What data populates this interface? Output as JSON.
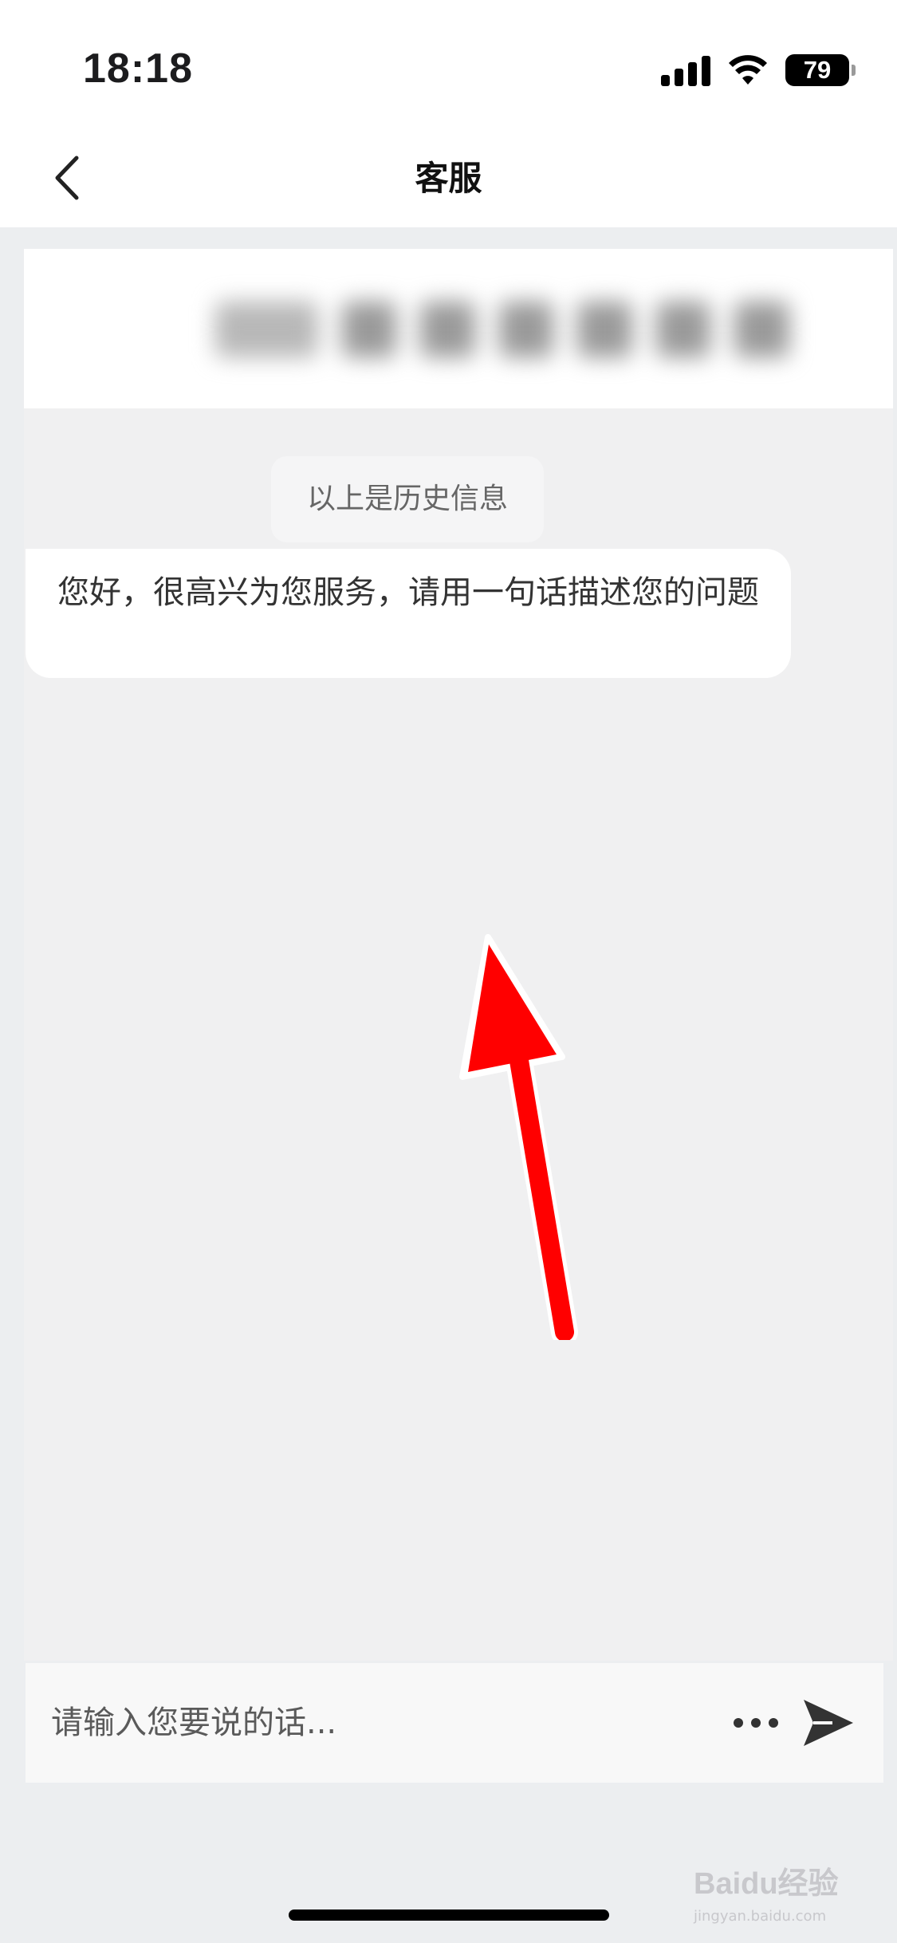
{
  "status_bar": {
    "time": "18:18",
    "battery": "79",
    "icons": [
      "signal-icon",
      "wifi-icon",
      "battery-icon"
    ]
  },
  "nav": {
    "title": "客服",
    "back_icon": "chevron-left-icon"
  },
  "chat": {
    "history_notice": "以上是历史信息",
    "messages": [
      {
        "sender": "agent",
        "text": "您好，很高兴为您服务，请用一句话描述您的问题"
      }
    ]
  },
  "input_bar": {
    "placeholder": "请输入您要说的话...",
    "value": "",
    "more_icon": "more-dots-icon",
    "send_icon": "send-icon"
  },
  "watermark": {
    "text": "Baidu经验",
    "sub": "jingyan.baidu.com"
  },
  "colors": {
    "background": "#eceef0",
    "chat_background": "#f0f0f1",
    "bubble": "#ffffff",
    "annotation_arrow": "#ff0000"
  }
}
